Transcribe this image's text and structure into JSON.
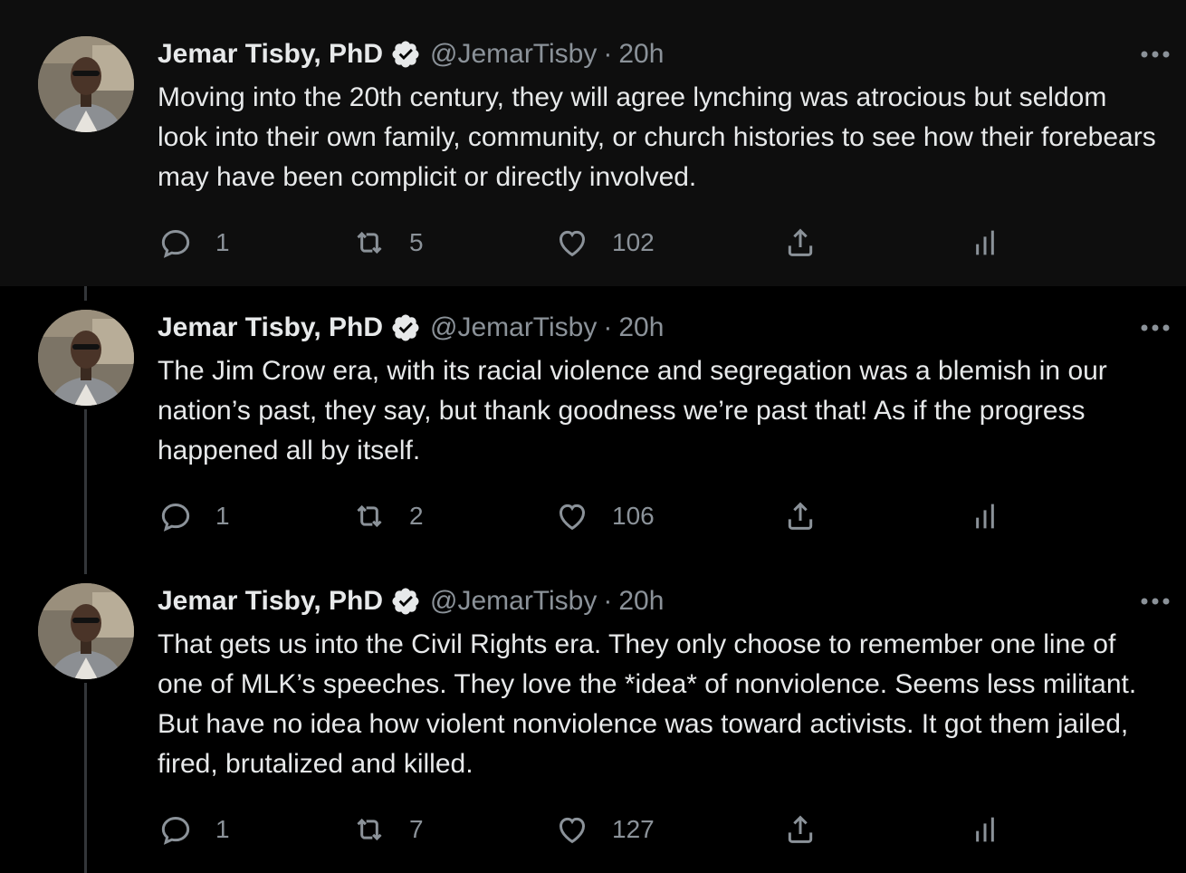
{
  "author": {
    "name": "Jemar Tisby, PhD",
    "handle": "@JemarTisby",
    "separator": "·",
    "time": "20h"
  },
  "tweets": [
    {
      "text": "Moving into the 20th century, they will agree lynching was atrocious but seldom look into their own family, community, or church histories to see how their forebears may have been complicit or directly involved.",
      "replies": "1",
      "retweets": "5",
      "likes": "102"
    },
    {
      "text": "The Jim Crow era, with its racial violence and segregation was a blemish in our nation’s past, they say, but thank goodness we’re past that! As if the progress happened all by itself.",
      "replies": "1",
      "retweets": "2",
      "likes": "106"
    },
    {
      "text": "That gets us into the Civil Rights era. They only choose to remember one line of one of MLK’s speeches. They love the *idea* of nonviolence. Seems less militant. But have no idea how violent nonviolence was toward activists. It got them jailed, fired, brutalized and killed.",
      "replies": "1",
      "retweets": "7",
      "likes": "127"
    }
  ],
  "icons": [
    "reply-icon",
    "retweet-icon",
    "like-icon",
    "share-icon",
    "analytics-icon",
    "verified-badge-icon",
    "more-icon"
  ],
  "colors": {
    "background": "#000000",
    "highlight_background": "#0e0e0e",
    "text": "#e7e9ea",
    "muted": "#8b9299",
    "thread_line": "#333639"
  }
}
